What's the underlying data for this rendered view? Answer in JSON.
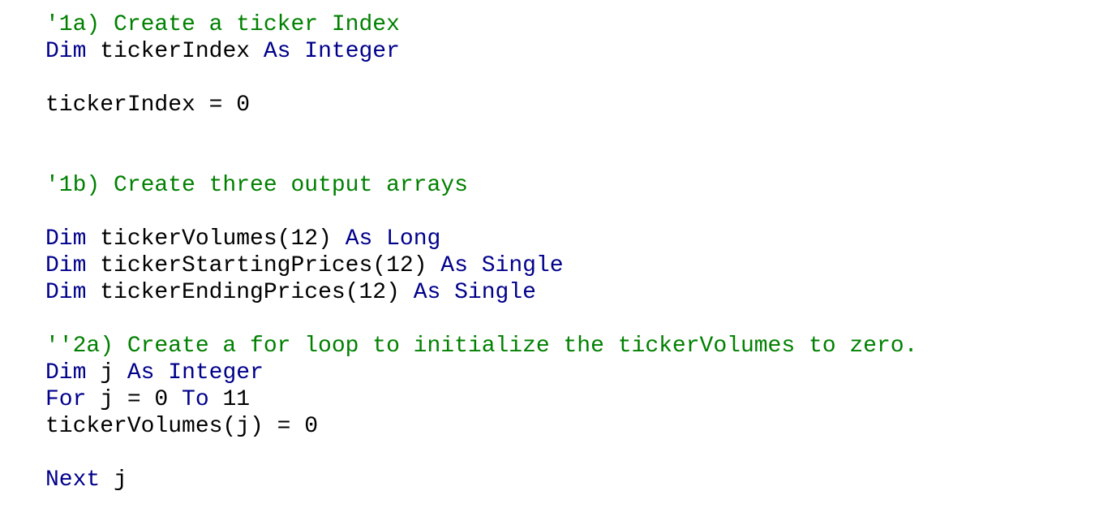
{
  "code": {
    "colors": {
      "comment": "#008000",
      "keyword": "#00008b",
      "plain": "#000000",
      "background": "#ffffff"
    },
    "lines": [
      {
        "tokens": [
          {
            "text": "'1a) Create a ticker Index",
            "kind": "comment"
          }
        ]
      },
      {
        "tokens": [
          {
            "text": "Dim",
            "kind": "keyword"
          },
          {
            "text": " tickerIndex ",
            "kind": "plain"
          },
          {
            "text": "As",
            "kind": "keyword"
          },
          {
            "text": " ",
            "kind": "plain"
          },
          {
            "text": "Integer",
            "kind": "keyword"
          }
        ]
      },
      {
        "tokens": []
      },
      {
        "tokens": [
          {
            "text": "tickerIndex = 0",
            "kind": "plain"
          }
        ]
      },
      {
        "tokens": []
      },
      {
        "tokens": []
      },
      {
        "tokens": [
          {
            "text": "'1b) Create three output arrays",
            "kind": "comment"
          }
        ]
      },
      {
        "tokens": []
      },
      {
        "tokens": [
          {
            "text": "Dim",
            "kind": "keyword"
          },
          {
            "text": " tickerVolumes(12) ",
            "kind": "plain"
          },
          {
            "text": "As",
            "kind": "keyword"
          },
          {
            "text": " ",
            "kind": "plain"
          },
          {
            "text": "Long",
            "kind": "keyword"
          }
        ]
      },
      {
        "tokens": [
          {
            "text": "Dim",
            "kind": "keyword"
          },
          {
            "text": " tickerStartingPrices(12) ",
            "kind": "plain"
          },
          {
            "text": "As",
            "kind": "keyword"
          },
          {
            "text": " ",
            "kind": "plain"
          },
          {
            "text": "Single",
            "kind": "keyword"
          }
        ]
      },
      {
        "tokens": [
          {
            "text": "Dim",
            "kind": "keyword"
          },
          {
            "text": " tickerEndingPrices(12) ",
            "kind": "plain"
          },
          {
            "text": "As",
            "kind": "keyword"
          },
          {
            "text": " ",
            "kind": "plain"
          },
          {
            "text": "Single",
            "kind": "keyword"
          }
        ]
      },
      {
        "tokens": []
      },
      {
        "tokens": [
          {
            "text": "''2a) Create a for loop to initialize the tickerVolumes to zero.",
            "kind": "comment"
          }
        ]
      },
      {
        "tokens": [
          {
            "text": "Dim",
            "kind": "keyword"
          },
          {
            "text": " j ",
            "kind": "plain"
          },
          {
            "text": "As",
            "kind": "keyword"
          },
          {
            "text": " ",
            "kind": "plain"
          },
          {
            "text": "Integer",
            "kind": "keyword"
          }
        ]
      },
      {
        "tokens": [
          {
            "text": "For",
            "kind": "keyword"
          },
          {
            "text": " j = 0 ",
            "kind": "plain"
          },
          {
            "text": "To",
            "kind": "keyword"
          },
          {
            "text": " 11",
            "kind": "plain"
          }
        ]
      },
      {
        "tokens": [
          {
            "text": "tickerVolumes(j) = 0",
            "kind": "plain"
          }
        ]
      },
      {
        "tokens": []
      },
      {
        "tokens": [
          {
            "text": "Next",
            "kind": "keyword"
          },
          {
            "text": " j",
            "kind": "plain"
          }
        ]
      }
    ]
  }
}
